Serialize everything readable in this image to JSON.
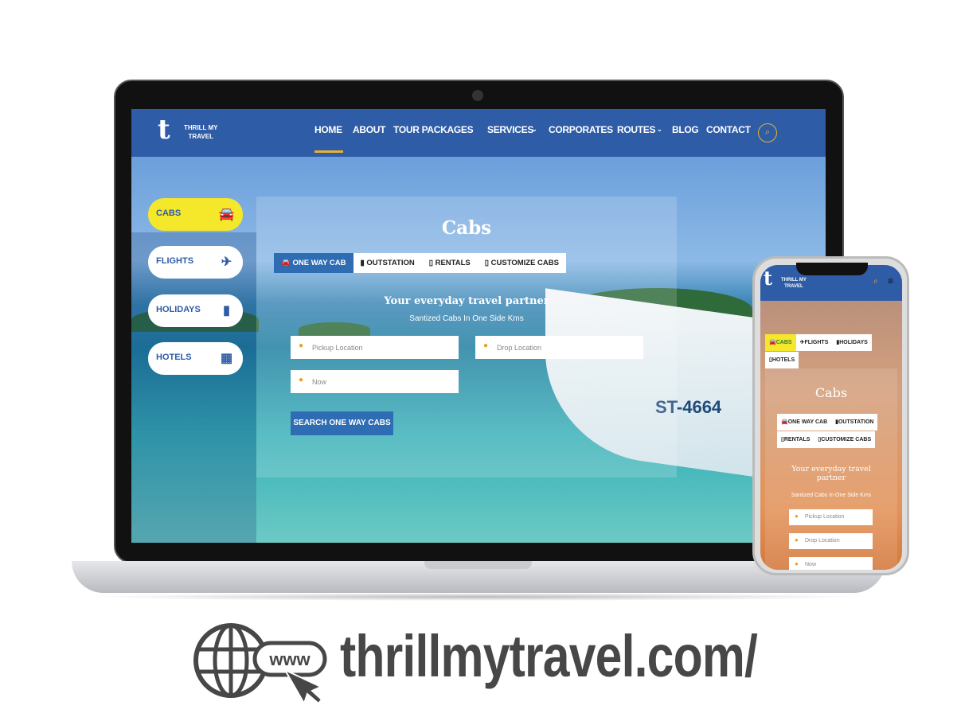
{
  "brand": {
    "logo_text_line1": "THRILL MY",
    "logo_text_line2": "TRAVEL"
  },
  "nav": {
    "items": [
      "HOME",
      "ABOUT",
      "TOUR PACKAGES",
      "SERVICES",
      "CORPORATES",
      "ROUTES",
      "BLOG",
      "CONTACT"
    ],
    "active": "HOME"
  },
  "side_tabs": [
    "CABS",
    "FLIGHTS",
    "HOLIDAYS",
    "HOTELS"
  ],
  "panel": {
    "title": "Cabs",
    "tabs": [
      "ONE WAY CAB",
      "OUTSTATION",
      "RENTALS",
      "CUSTOMIZE CABS"
    ],
    "heading": "Your everyday travel partner",
    "subheading": "Santized Cabs In One Side Kms",
    "pickup_placeholder": "Pickup Location",
    "drop_placeholder": "Drop Location",
    "time_placeholder": "Now",
    "search_button": "SEARCH ONE WAY CABS"
  },
  "boat_label": "ST-4664",
  "mobile": {
    "top_tabs": [
      "CABS",
      "FLIGHTS",
      "HOLIDAYS",
      "HOTELS"
    ],
    "title": "Cabs",
    "tabs": [
      "ONE WAY CAB",
      "OUTSTATION",
      "RENTALS",
      "CUSTOMIZE CABS"
    ],
    "heading": "Your everyday travel partner",
    "subheading": "Santized Cabs In One Side Kms",
    "pickup_placeholder": "Pickup Location",
    "drop_placeholder": "Drop Location",
    "time_placeholder": "Now"
  },
  "footer": {
    "www": "www",
    "url": "thrillmytravel.com/"
  },
  "colors": {
    "nav_blue": "#2e5ca7",
    "accent_yellow": "#f5e72a",
    "button_blue": "#2e6db4",
    "pin_orange": "#e8a020"
  }
}
